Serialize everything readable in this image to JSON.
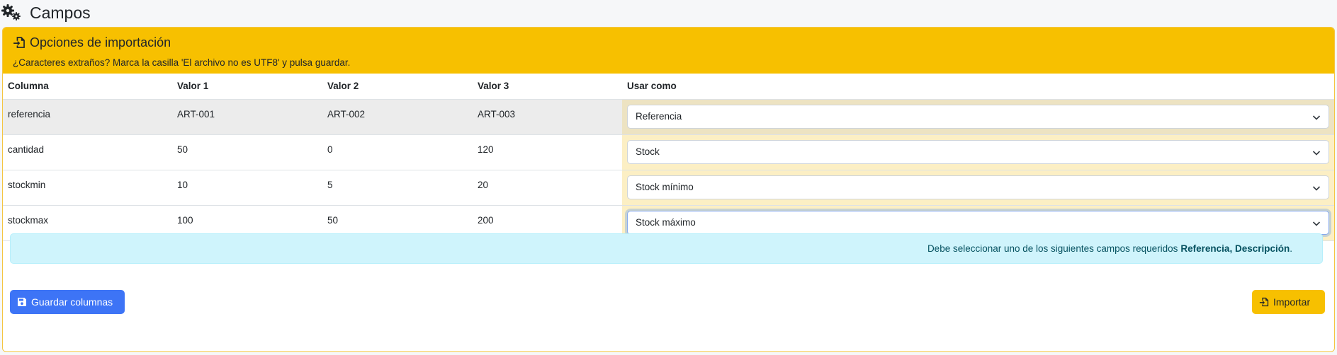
{
  "page": {
    "title": "Campos"
  },
  "card": {
    "title": "Opciones de importación",
    "subtitle": "¿Caracteres extraños? Marca la casilla 'El archivo no es UTF8' y pulsa guardar."
  },
  "table": {
    "headers": [
      "Columna",
      "Valor 1",
      "Valor 2",
      "Valor 3",
      "Usar como"
    ],
    "rows": [
      {
        "columna": "referencia",
        "v1": "ART-001",
        "v2": "ART-002",
        "v3": "ART-003",
        "usar": "Referencia"
      },
      {
        "columna": "cantidad",
        "v1": "50",
        "v2": "0",
        "v3": "120",
        "usar": "Stock"
      },
      {
        "columna": "stockmin",
        "v1": "10",
        "v2": "5",
        "v3": "20",
        "usar": "Stock mínimo"
      },
      {
        "columna": "stockmax",
        "v1": "100",
        "v2": "50",
        "v3": "200",
        "usar": "Stock máximo"
      }
    ]
  },
  "alert": {
    "text": "Debe seleccionar uno de los siguientes campos requeridos",
    "fields": "Referencia, Descripción",
    "end": "."
  },
  "buttons": {
    "save": "Guardar columnas",
    "import": "Importar"
  },
  "colors": {
    "warning": "#f7c000",
    "primary": "#3d74f6",
    "info_bg": "#cff4fc"
  }
}
